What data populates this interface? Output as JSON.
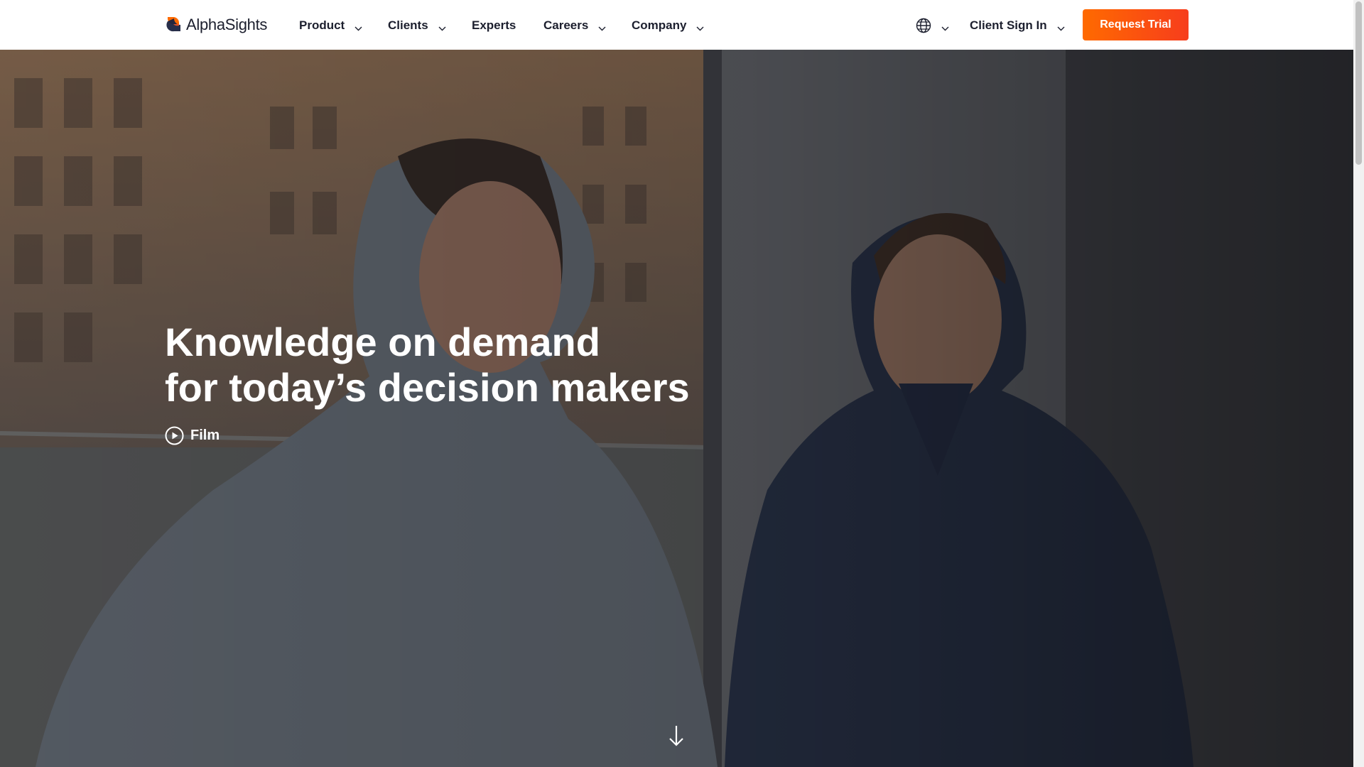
{
  "brand": {
    "name": "AlphaSights",
    "logo_colors": {
      "orange": "#ff6a00",
      "navy": "#1c2340"
    }
  },
  "nav": {
    "items": [
      {
        "label": "Product",
        "has_dropdown": true
      },
      {
        "label": "Clients",
        "has_dropdown": true
      },
      {
        "label": "Experts",
        "has_dropdown": false
      },
      {
        "label": "Careers",
        "has_dropdown": true
      },
      {
        "label": "Company",
        "has_dropdown": true
      }
    ],
    "language_icon": "globe-icon",
    "client_sign_in": "Client Sign In",
    "request_trial": "Request Trial",
    "cta_gradient": [
      "#ff6a00",
      "#f73d1c"
    ]
  },
  "hero": {
    "title_line_1": "Knowledge on demand",
    "title_line_2": "for today’s decision makers",
    "film_label": "Film",
    "film_icon": "play-icon",
    "scroll_icon": "arrow-down-icon"
  }
}
